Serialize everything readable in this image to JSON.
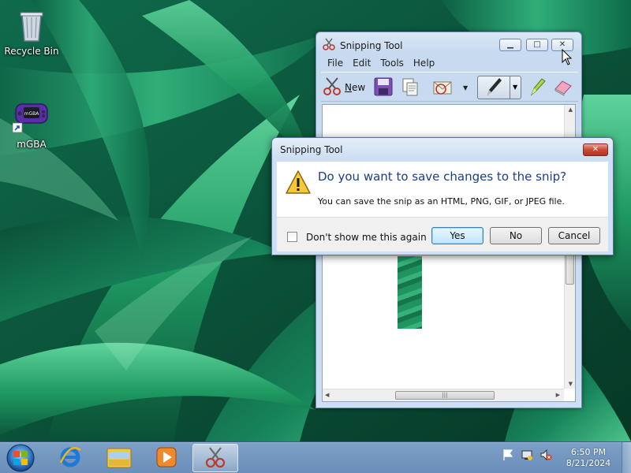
{
  "desktop": {
    "icons": [
      {
        "label": "Recycle Bin",
        "icon": "recycle-bin-icon"
      },
      {
        "label": "mGBA",
        "icon": "mgba-app-icon"
      }
    ]
  },
  "snipping_tool": {
    "title": "Snipping Tool",
    "menu": [
      "File",
      "Edit",
      "Tools",
      "Help"
    ],
    "toolbar": {
      "new_label": "New",
      "buttons": [
        "scissors-icon",
        "save-icon",
        "copy-icon",
        "send-snip-icon",
        "pen-icon",
        "highlighter-icon",
        "eraser-icon"
      ]
    }
  },
  "dialog": {
    "title": "Snipping Tool",
    "heading": "Do you want to save changes to the snip?",
    "message": "You can save the snip as an HTML, PNG, GIF, or JPEG file.",
    "checkbox_label": "Don't show me this again",
    "checkbox_checked": false,
    "buttons": {
      "yes": "Yes",
      "no": "No",
      "cancel": "Cancel"
    }
  },
  "taskbar": {
    "apps": [
      "internet-explorer-icon",
      "windows-explorer-icon",
      "media-player-icon",
      "snipping-tool-icon"
    ],
    "tray": [
      "action-center-flag-icon",
      "network-icon",
      "volume-muted-icon"
    ],
    "clock": {
      "time": "6:50 PM",
      "date": "8/21/2024"
    }
  },
  "colors": {
    "dialog_heading": "#1a3e8c",
    "taskbar": "#7397bf",
    "close_button": "#c94a35"
  }
}
